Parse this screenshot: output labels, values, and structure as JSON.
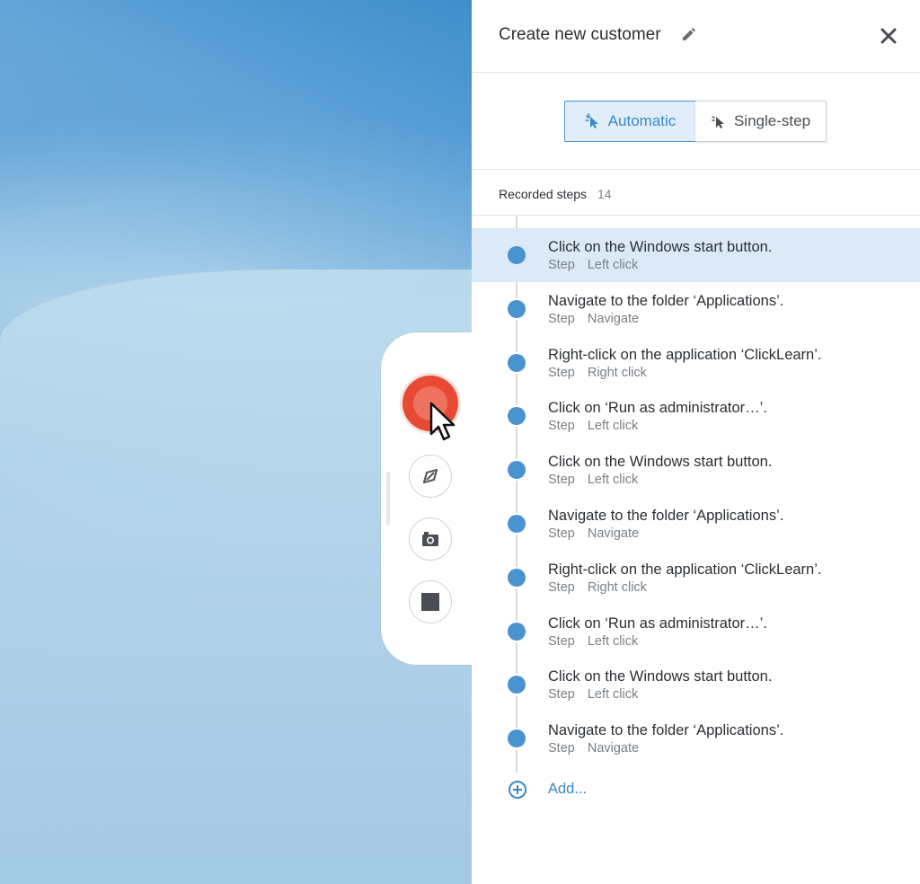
{
  "panel": {
    "title": "Create new customer",
    "modes": {
      "automatic": "Automatic",
      "single_step": "Single-step"
    },
    "steps_header": {
      "label": "Recorded steps",
      "count": "14"
    },
    "steps": [
      {
        "title": "Click on the Windows start button.",
        "kind": "Step",
        "type": "Left click",
        "active": true
      },
      {
        "title": "Navigate to the folder ‘Applications’.",
        "kind": "Step",
        "type": "Navigate"
      },
      {
        "title": "Right-click on the application ‘ClickLearn’.",
        "kind": "Step",
        "type": "Right click"
      },
      {
        "title": "Click on ‘Run as administrator…’.",
        "kind": "Step",
        "type": "Left click"
      },
      {
        "title": "Click on the Windows start button.",
        "kind": "Step",
        "type": "Left click"
      },
      {
        "title": "Navigate to the folder ‘Applications’.",
        "kind": "Step",
        "type": "Navigate"
      },
      {
        "title": "Right-click on the application ‘ClickLearn’.",
        "kind": "Step",
        "type": "Right click"
      },
      {
        "title": "Click on ‘Run as administrator…’.",
        "kind": "Step",
        "type": "Left click"
      },
      {
        "title": "Click on the Windows start button.",
        "kind": "Step",
        "type": "Left click"
      },
      {
        "title": "Navigate to the folder ‘Applications’.",
        "kind": "Step",
        "type": "Navigate"
      }
    ],
    "add_label": "Add..."
  },
  "colors": {
    "accent": "#3a89c9",
    "active_row": "#dceaf7",
    "record": "#e84a33"
  },
  "recorder": {
    "icons": [
      "record-icon",
      "compass-icon",
      "camera-icon",
      "stop-icon"
    ]
  }
}
